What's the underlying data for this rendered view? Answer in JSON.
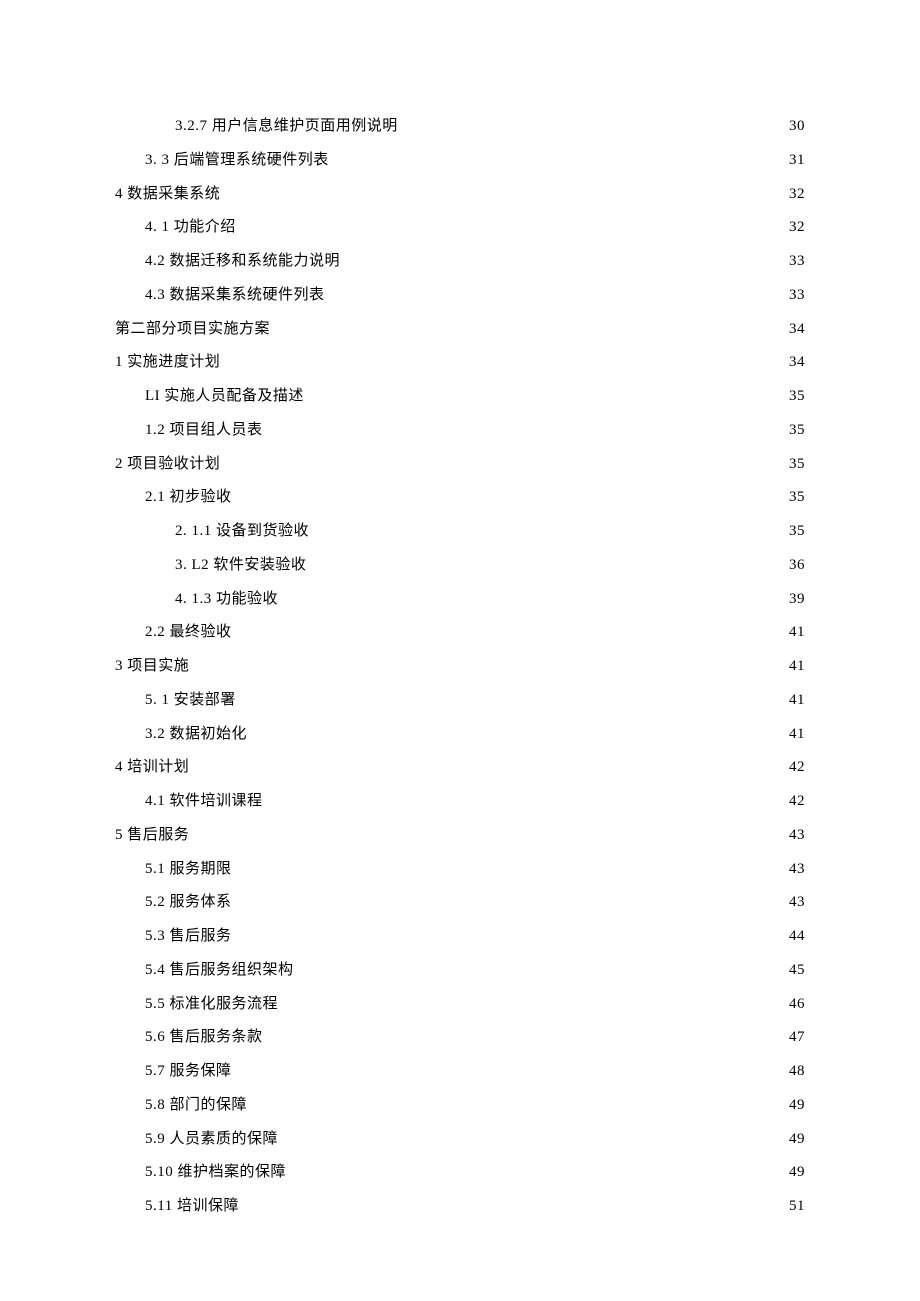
{
  "toc": [
    {
      "label": "3.2.7 用户信息维护页面用例说明",
      "page": "30",
      "level": 2
    },
    {
      "label": "3. 3 后端管理系统硬件列表",
      "page": "31",
      "level": 1
    },
    {
      "label": "4 数据采集系统",
      "page": "32",
      "level": 0
    },
    {
      "label": "4. 1 功能介绍",
      "page": "32",
      "level": 1
    },
    {
      "label": "4.2 数据迁移和系统能力说明",
      "page": "33",
      "level": 1
    },
    {
      "label": "4.3 数据采集系统硬件列表",
      "page": "33",
      "level": 1
    },
    {
      "label": "第二部分项目实施方案",
      "page": "34",
      "level": 0
    },
    {
      "label": "1 实施进度计划",
      "page": "34",
      "level": 0
    },
    {
      "label": "LI 实施人员配备及描述",
      "page": "35",
      "level": 1
    },
    {
      "label": "1.2 项目组人员表",
      "page": "35",
      "level": 1
    },
    {
      "label": "2 项目验收计划",
      "page": "35",
      "level": 0
    },
    {
      "label": "2.1 初步验收",
      "page": "35",
      "level": 1
    },
    {
      "label": "2. 1.1 设备到货验收",
      "page": "35",
      "level": 2
    },
    {
      "label": "3. L2 软件安装验收",
      "page": "36",
      "level": 2
    },
    {
      "label": "4. 1.3 功能验收",
      "page": "39",
      "level": 2
    },
    {
      "label": "2.2 最终验收",
      "page": "41",
      "level": 1
    },
    {
      "label": "3 项目实施",
      "page": "41",
      "level": 0
    },
    {
      "label": "5. 1 安装部署",
      "page": "41",
      "level": 1
    },
    {
      "label": "3.2 数据初始化",
      "page": "41",
      "level": 1
    },
    {
      "label": "4 培训计划",
      "page": "42",
      "level": 0
    },
    {
      "label": "4.1 软件培训课程",
      "page": "42",
      "level": 1
    },
    {
      "label": "5 售后服务",
      "page": "43",
      "level": 0
    },
    {
      "label": "5.1  服务期限",
      "page": "43",
      "level": 1
    },
    {
      "label": "5.2  服务体系",
      "page": "43",
      "level": 1
    },
    {
      "label": "5.3 售后服务",
      "page": "44",
      "level": 1
    },
    {
      "label": "5.4 售后服务组织架构",
      "page": "45",
      "level": 1
    },
    {
      "label": "5.5 标准化服务流程",
      "page": "46",
      "level": 1
    },
    {
      "label": "5.6 售后服务条款",
      "page": "47",
      "level": 1
    },
    {
      "label": "5.7 服务保障",
      "page": "48",
      "level": 1
    },
    {
      "label": "5.8  部门的保障",
      "page": "49",
      "level": 1
    },
    {
      "label": "5.9  人员素质的保障",
      "page": "49",
      "level": 1
    },
    {
      "label": "5.10   维护档案的保障",
      "page": "49",
      "level": 1
    },
    {
      "label": "5.11   培训保障",
      "page": "51",
      "level": 1
    }
  ]
}
